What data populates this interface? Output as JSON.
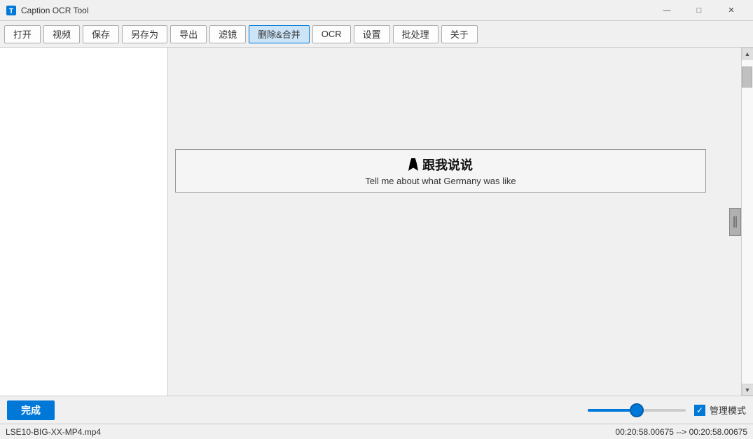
{
  "titlebar": {
    "title": "Caption OCR Tool",
    "minimize_label": "—",
    "maximize_label": "□",
    "close_label": "✕"
  },
  "toolbar": {
    "buttons": [
      {
        "id": "open",
        "label": "打开"
      },
      {
        "id": "video",
        "label": "视频"
      },
      {
        "id": "save",
        "label": "保存"
      },
      {
        "id": "saveas",
        "label": "另存为"
      },
      {
        "id": "export",
        "label": "导出"
      },
      {
        "id": "filter",
        "label": "滤镜"
      },
      {
        "id": "delete_merge",
        "label": "删除&合并"
      },
      {
        "id": "ocr",
        "label": "OCR"
      },
      {
        "id": "settings",
        "label": "设置"
      },
      {
        "id": "batch",
        "label": "批处理"
      },
      {
        "id": "about",
        "label": "关于"
      }
    ]
  },
  "caption": {
    "line1": "跟我说说",
    "line2": "Tell me about what Germany was like"
  },
  "bottombar": {
    "done_label": "完成",
    "checkbox_label": "管理模式",
    "slider_value": 50
  },
  "statusbar": {
    "file": "LSE10-BIG-XX-MP4.mp4",
    "time": "00:20:58.00675 --> 00:20:58.00675"
  }
}
